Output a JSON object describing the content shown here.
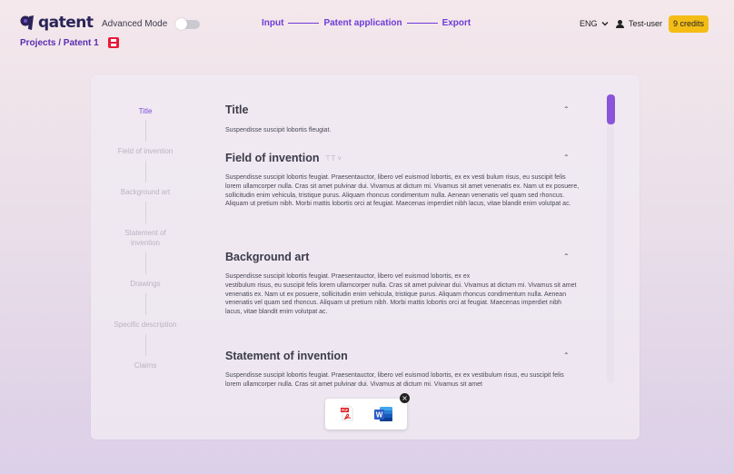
{
  "header": {
    "logo_text": "qatent",
    "advanced_mode_label": "Advanced Mode",
    "advanced_mode_on": false,
    "breadcrumb": "Projects / Patent 1",
    "steps": [
      "Input",
      "Patent application",
      "Export"
    ],
    "language": "ENG",
    "user_name": "Test-user",
    "credits": "9 credits"
  },
  "toc": {
    "items": [
      {
        "label": "Title",
        "active": true
      },
      {
        "label": "Field of invention",
        "active": false
      },
      {
        "label": "Background art",
        "active": false
      },
      {
        "label": "Statement of invention",
        "active": false
      },
      {
        "label": "Drawings",
        "active": false
      },
      {
        "label": "Specific description",
        "active": false
      },
      {
        "label": "Claims",
        "active": false
      }
    ]
  },
  "sections": {
    "title": {
      "heading": "Title",
      "body": "Suspendisse suscipit lobortis fleugiat."
    },
    "field": {
      "heading": "Field of invention",
      "body": "Suspendisse suscipit lobortis feugiat. Praesentauctor, libero vel euismod lobortis, ex ex vesti  bulum risus, eu suscipit felis lorem ullamcorper nulla. Cras sit amet pulvinar dui. Vivamus at dictum mi. Vivamus sit amet venenatis ex. Nam ut ex posuere, sollicitudin enim vehicula, tristique purus. Aliquam rhoncus condimentum nulla. Aenean venenatis vel quam sed rhoncus. Aliquam ut pretium nibh. Morbi mattis lobortis orci at feugiat. Maecenas imperdiet nibh lacus, vitae blandit enim volutpat ac."
    },
    "background": {
      "heading": "Background art",
      "body_line1": "Suspendisse suscipit lobortis feugiat. Praesentauctor, libero vel euismod lobortis, ex ex",
      "body_rest": "vestibulum risus, eu suscipit felis lorem ullamcorper nulla. Cras sit amet pulvinar dui. Vivamus at dictum mi. Vivamus sit amet venenatis ex. Nam ut ex posuere, sollicitudin enim vehicula, tristique purus. Aliquam rhoncus condimentum nulla. Aenean venenatis vel quam sed rhoncus. Aliquam ut pretium nibh. Morbi mattis lobortis orci at feugiat. Maecenas imperdiet nibh lacus, vitae blandit enim volutpat ac."
    },
    "statement": {
      "heading": "Statement of invention",
      "body": "Suspendisse suscipit lobortis feugiat. Praesentauctor, libero vel euismod lobortis, ex ex vestibulum risus, eu suscipit felis lorem ullamcorper nulla. Cras sit amet pulvinar dui. Vivamus at dictum mi. Vivamus sit amet"
    }
  },
  "export": {
    "pdf_label": "PDF",
    "word_label": "W"
  },
  "colors": {
    "accent": "#6e3bd6",
    "credits_bg": "#f4bd16",
    "save_red": "#e81b3a",
    "pdf_red": "#e31c23",
    "word_blue": "#2b5cc4"
  }
}
